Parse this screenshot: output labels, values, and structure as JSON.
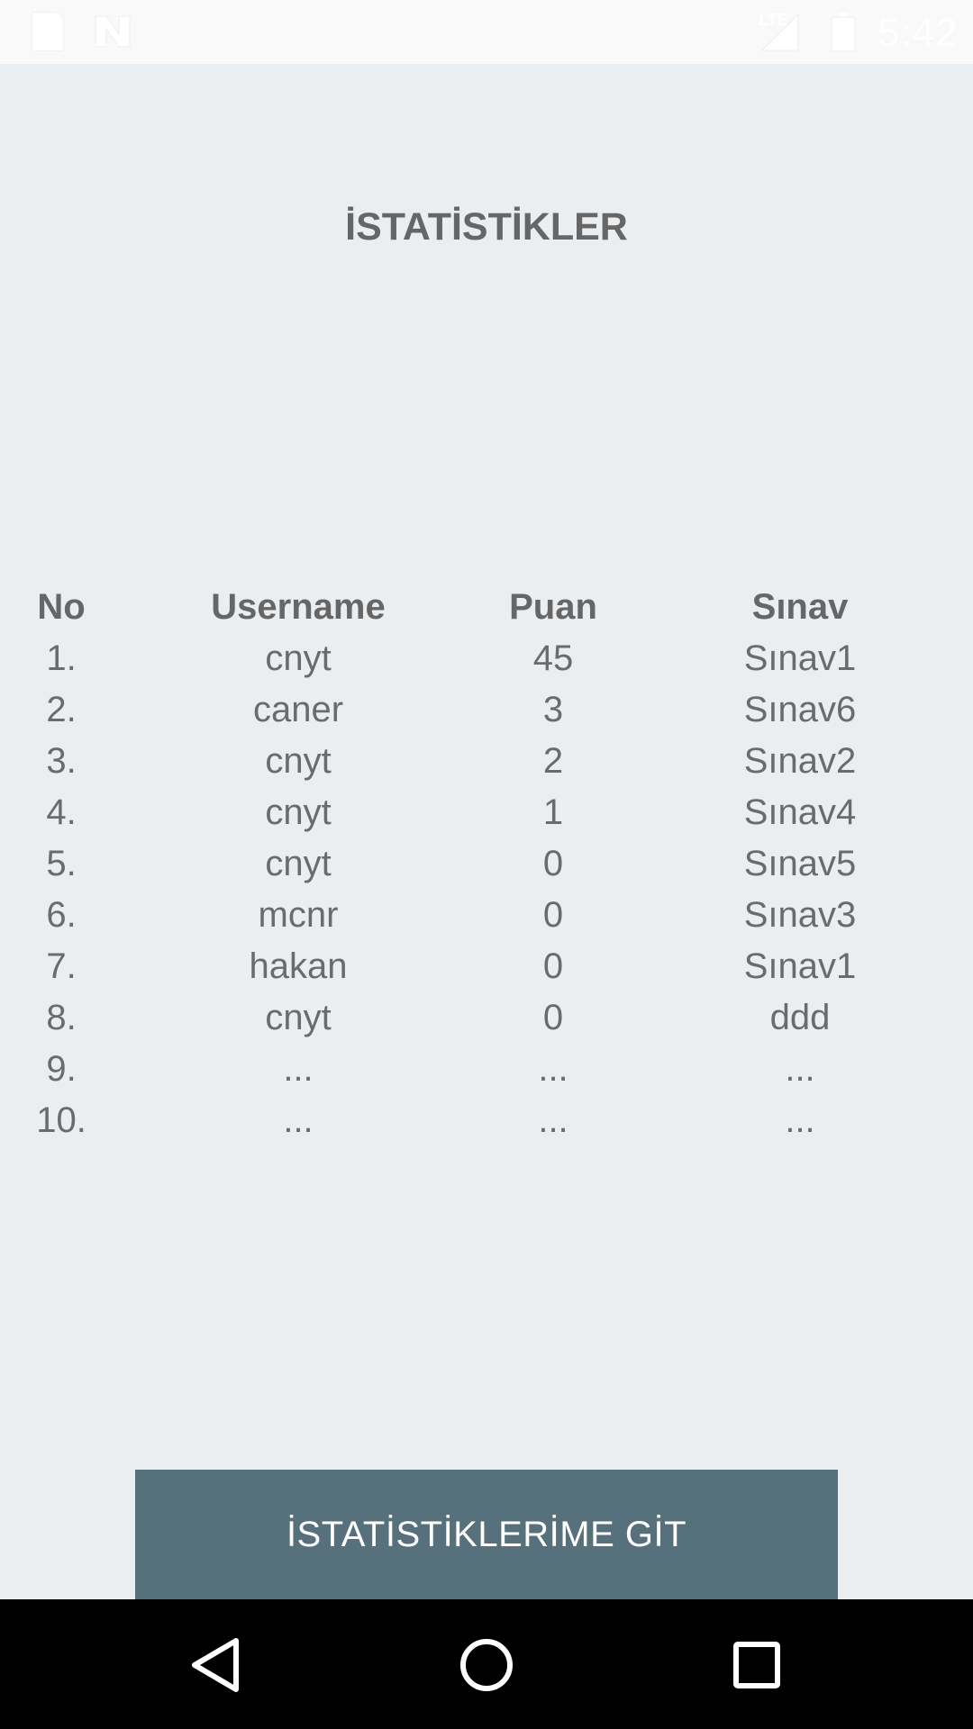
{
  "status_bar": {
    "network": "LTE",
    "time": "5:42",
    "icons": [
      "sd-card-icon",
      "n-notification-icon",
      "signal-icon",
      "battery-icon"
    ]
  },
  "title": "İSTATİSTİKLER",
  "table": {
    "headers": [
      "No",
      "Username",
      "Puan",
      "Sınav"
    ],
    "rows": [
      [
        "1.",
        "cnyt",
        "45",
        "Sınav1"
      ],
      [
        "2.",
        "caner",
        "3",
        "Sınav6"
      ],
      [
        "3.",
        "cnyt",
        "2",
        "Sınav2"
      ],
      [
        "4.",
        "cnyt",
        "1",
        "Sınav4"
      ],
      [
        "5.",
        "cnyt",
        "0",
        "Sınav5"
      ],
      [
        "6.",
        "mcnr",
        "0",
        "Sınav3"
      ],
      [
        "7.",
        "hakan",
        "0",
        "Sınav1"
      ],
      [
        "8.",
        "cnyt",
        "0",
        "ddd"
      ],
      [
        "9.",
        "...",
        "...",
        "..."
      ],
      [
        "10.",
        "...",
        "...",
        "..."
      ]
    ]
  },
  "button": {
    "label": "İSTATİSTİKLERİME GİT"
  },
  "nav_bar": {
    "icons": [
      "back-icon",
      "home-icon",
      "recents-icon"
    ]
  },
  "colors": {
    "background": "#ebeef1",
    "button": "#56707c",
    "text": "#6b6b6b",
    "status_bar": "#f9f9f9"
  }
}
